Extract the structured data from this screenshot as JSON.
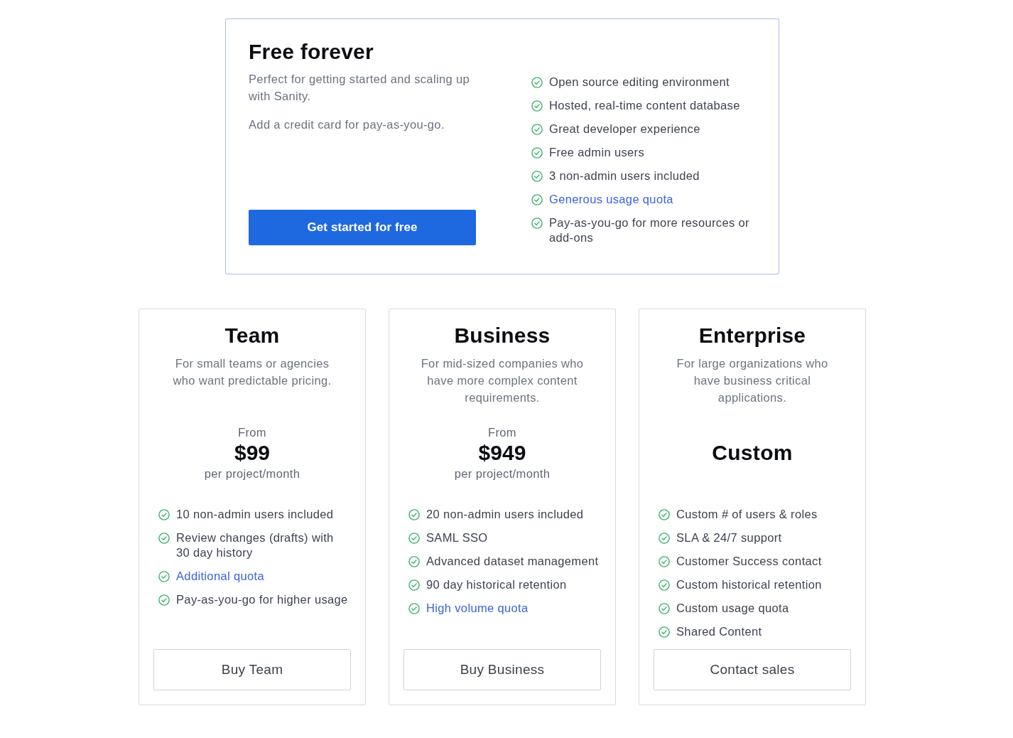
{
  "free_plan": {
    "title": "Free forever",
    "description": [
      "Perfect for getting started and scaling up with Sanity.",
      "Add a credit card for pay-as-you-go."
    ],
    "button": "Get started for free",
    "features": [
      {
        "text": "Open source editing environment",
        "kind": "text"
      },
      {
        "text": "Hosted, real-time content database",
        "kind": "text"
      },
      {
        "text": "Great developer experience",
        "kind": "text"
      },
      {
        "text": "Free admin users",
        "kind": "text"
      },
      {
        "text": "3 non-admin users included",
        "kind": "text"
      },
      {
        "text": "Generous usage quota",
        "kind": "link"
      },
      {
        "text": "Pay-as-you-go for more resources or add-ons",
        "kind": "text"
      }
    ]
  },
  "plans": [
    {
      "name": "Team",
      "description": "For small teams or agencies who want predictable pricing.",
      "pricing": {
        "kind": "fixed",
        "prefix": "From",
        "amount": "$99",
        "unit": "per project/month"
      },
      "features": [
        {
          "text": "10 non-admin users included",
          "kind": "text"
        },
        {
          "text": "Review changes (drafts) with 30 day history",
          "kind": "text"
        },
        {
          "text": "Additional quota",
          "kind": "link"
        },
        {
          "text": "Pay-as-you-go for higher usage",
          "kind": "text"
        }
      ],
      "button": "Buy Team"
    },
    {
      "name": "Business",
      "description": "For mid-sized companies who have more complex content requirements.",
      "pricing": {
        "kind": "fixed",
        "prefix": "From",
        "amount": "$949",
        "unit": "per project/month"
      },
      "features": [
        {
          "text": "20 non-admin users included",
          "kind": "text"
        },
        {
          "text": "SAML SSO",
          "kind": "text"
        },
        {
          "text": "Advanced dataset management",
          "kind": "text"
        },
        {
          "text": "90 day historical retention",
          "kind": "text"
        },
        {
          "text": "High volume quota",
          "kind": "link"
        }
      ],
      "button": "Buy Business"
    },
    {
      "name": "Enterprise",
      "description": "For large organizations who have business critical applications.",
      "pricing": {
        "kind": "custom",
        "amount": "Custom"
      },
      "features": [
        {
          "text": "Custom # of users & roles",
          "kind": "text"
        },
        {
          "text": "SLA & 24/7 support",
          "kind": "text"
        },
        {
          "text": "Customer Success contact",
          "kind": "text"
        },
        {
          "text": "Custom historical retention",
          "kind": "text"
        },
        {
          "text": "Custom usage quota",
          "kind": "text"
        },
        {
          "text": "Shared Content",
          "kind": "text"
        }
      ],
      "button": "Contact sales"
    }
  ]
}
